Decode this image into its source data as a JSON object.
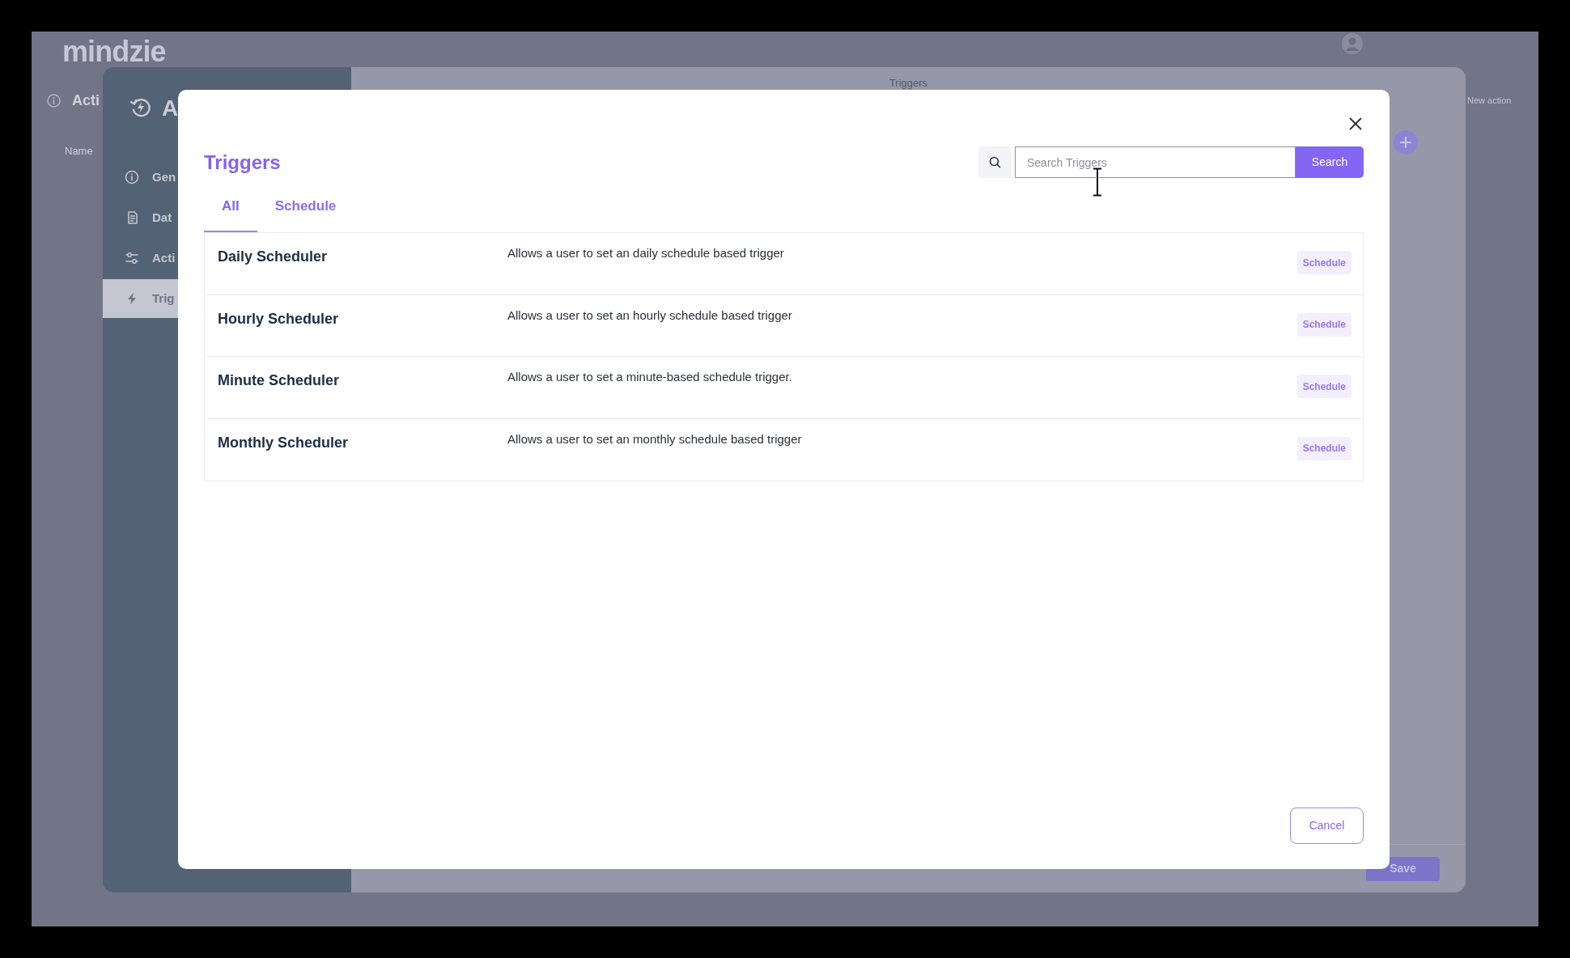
{
  "page": {
    "logo": "mindzie",
    "title": "Acti",
    "new_action": "New action",
    "name_label": "Name"
  },
  "panel": {
    "title": "A",
    "nav": [
      {
        "label": "Gen",
        "selected": false
      },
      {
        "label": "Dat",
        "selected": false
      },
      {
        "label": "Acti",
        "selected": false
      },
      {
        "label": "Trig",
        "selected": true
      }
    ],
    "header": "Triggers",
    "save": "Save"
  },
  "dialog": {
    "title": "Triggers",
    "search": {
      "placeholder": "Search Triggers",
      "button": "Search"
    },
    "tabs": [
      {
        "label": "All",
        "selected": true
      },
      {
        "label": "Schedule",
        "selected": false
      }
    ],
    "triggers": [
      {
        "name": "Daily Scheduler",
        "description": "Allows a user to set an daily schedule based trigger",
        "tag": "Schedule"
      },
      {
        "name": "Hourly Scheduler",
        "description": "Allows a user to set an hourly schedule based trigger",
        "tag": "Schedule"
      },
      {
        "name": "Minute Scheduler",
        "description": "Allows a user to set a minute-based schedule trigger.",
        "tag": "Schedule"
      },
      {
        "name": "Monthly Scheduler",
        "description": "Allows a user to set an monthly schedule based trigger",
        "tag": "Schedule"
      }
    ],
    "cancel": "Cancel"
  }
}
